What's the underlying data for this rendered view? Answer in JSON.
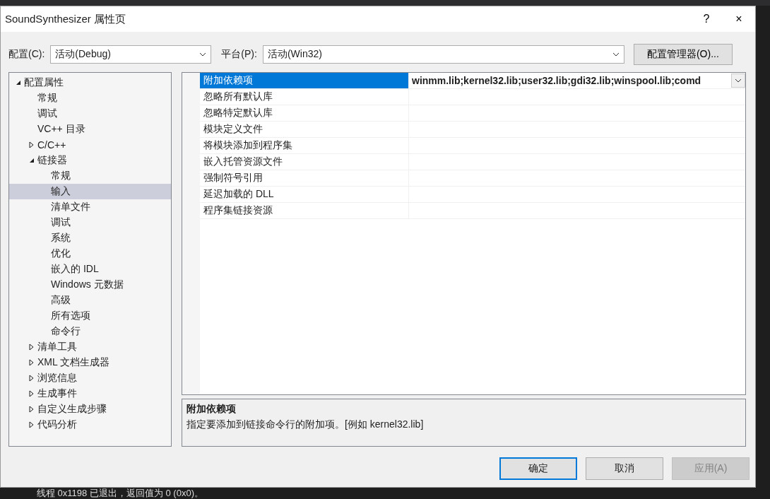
{
  "window": {
    "title": "SoundSynthesizer 属性页",
    "help_button": "?",
    "close_button": "×"
  },
  "config_bar": {
    "config_label": "配置(C):",
    "config_value": "活动(Debug)",
    "platform_label": "平台(P):",
    "platform_value": "活动(Win32)",
    "manager_button": "配置管理器(O)..."
  },
  "tree": [
    {
      "label": "配置属性",
      "expanded": true,
      "selected": false,
      "children": [
        {
          "label": "常规",
          "selected": false
        },
        {
          "label": "调试",
          "selected": false
        },
        {
          "label": "VC++ 目录",
          "selected": false
        },
        {
          "label": "C/C++",
          "expanded": false,
          "selected": false
        },
        {
          "label": "链接器",
          "expanded": true,
          "selected": false,
          "children": [
            {
              "label": "常规",
              "selected": false
            },
            {
              "label": "输入",
              "selected": true
            },
            {
              "label": "清单文件",
              "selected": false
            },
            {
              "label": "调试",
              "selected": false
            },
            {
              "label": "系统",
              "selected": false
            },
            {
              "label": "优化",
              "selected": false
            },
            {
              "label": "嵌入的 IDL",
              "selected": false
            },
            {
              "label": "Windows 元数据",
              "selected": false
            },
            {
              "label": "高级",
              "selected": false
            },
            {
              "label": "所有选项",
              "selected": false
            },
            {
              "label": "命令行",
              "selected": false
            }
          ]
        },
        {
          "label": "清单工具",
          "expanded": false,
          "selected": false
        },
        {
          "label": "XML 文档生成器",
          "expanded": false,
          "selected": false
        },
        {
          "label": "浏览信息",
          "expanded": false,
          "selected": false
        },
        {
          "label": "生成事件",
          "expanded": false,
          "selected": false
        },
        {
          "label": "自定义生成步骤",
          "expanded": false,
          "selected": false
        },
        {
          "label": "代码分析",
          "expanded": false,
          "selected": false
        }
      ]
    }
  ],
  "properties": [
    {
      "name": "附加依赖项",
      "value": "winmm.lib;kernel32.lib;user32.lib;gdi32.lib;winspool.lib;comd",
      "selected": true
    },
    {
      "name": "忽略所有默认库",
      "selected": false
    },
    {
      "name": "忽略特定默认库",
      "selected": false
    },
    {
      "name": "模块定义文件",
      "selected": false
    },
    {
      "name": "将模块添加到程序集",
      "selected": false
    },
    {
      "name": "嵌入托管资源文件",
      "selected": false
    },
    {
      "name": "强制符号引用",
      "selected": false
    },
    {
      "name": "延迟加载的 DLL",
      "selected": false
    },
    {
      "name": "程序集链接资源",
      "selected": false
    }
  ],
  "description": {
    "title": "附加依赖项",
    "text": "指定要添加到链接命令行的附加项。[例如 kernel32.lib]"
  },
  "buttons": [
    {
      "label": "确定",
      "default": true,
      "disabled": false
    },
    {
      "label": "取消",
      "default": false,
      "disabled": false
    },
    {
      "label": "应用(A)",
      "default": false,
      "disabled": true
    }
  ],
  "background_output": "线程 0x1198 已退出，返回值为 0 (0x0)。"
}
